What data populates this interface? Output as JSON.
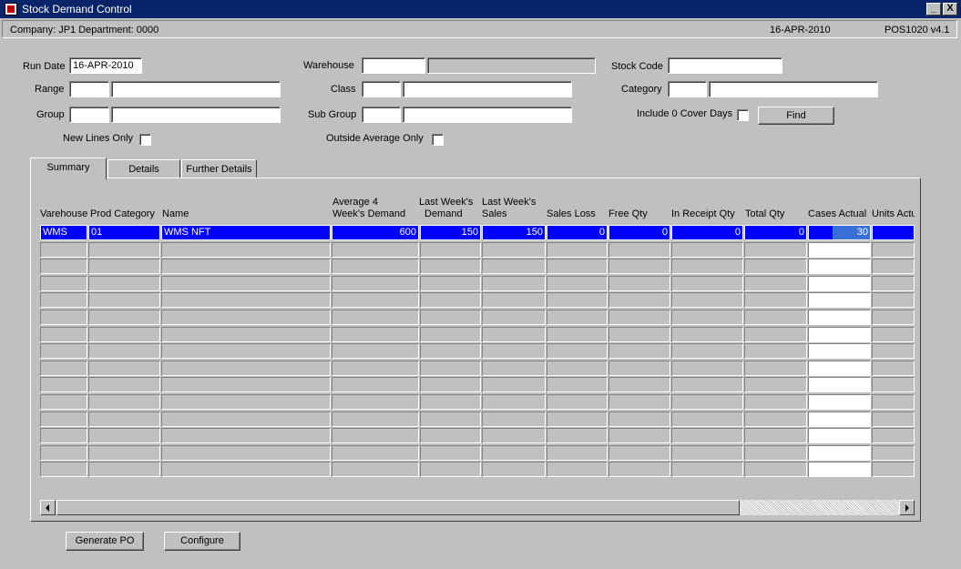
{
  "window": {
    "title": "Stock Demand Control",
    "minimize_label": "_",
    "close_label": "X"
  },
  "infobar": {
    "company_dept": "Company:  JP1   Department:  0000",
    "date": "16-APR-2010",
    "version": "POS1020  v4.1"
  },
  "form": {
    "run_date_label": "Run Date",
    "run_date_value": "16-APR-2010",
    "range_label": "Range",
    "group_label": "Group",
    "warehouse_label": "Warehouse",
    "class_label": "Class",
    "sub_group_label": "Sub Group",
    "stock_code_label": "Stock Code",
    "category_label": "Category",
    "include_zero_label": "Include 0 Cover Days",
    "new_lines_label": "New Lines Only",
    "outside_avg_label": "Outside Average Only",
    "find_label": "Find"
  },
  "tabs": [
    "Summary",
    "Details",
    "Further Details"
  ],
  "table": {
    "headers": {
      "warehouse": "Varehouse",
      "prod_category": "Prod Category",
      "name": "Name",
      "avg4_line1": "Average 4",
      "avg4_line2": "Week's Demand",
      "lwd_line1": "Last Week's",
      "lwd_line2": "Demand",
      "lws_line1": "Last Week's",
      "lws_line2": "Sales",
      "sales_loss": "Sales Loss",
      "free_qty": "Free Qty",
      "in_receipt_qty": "In Receipt Qty",
      "total_qty": "Total Qty",
      "cases_actual": "Cases Actual",
      "units_actual": "Units Actu"
    },
    "row1": {
      "warehouse": "WMS",
      "prod_category": "01",
      "name": "WMS NFT",
      "avg4": "600",
      "lwd": "150",
      "lws": "150",
      "sales_loss": "0",
      "free_qty": "0",
      "in_receipt_qty": "0",
      "total_qty": "0",
      "cases_actual": "30",
      "units_actual": ""
    }
  },
  "buttons": {
    "generate_po": "Generate PO",
    "configure": "Configure"
  }
}
